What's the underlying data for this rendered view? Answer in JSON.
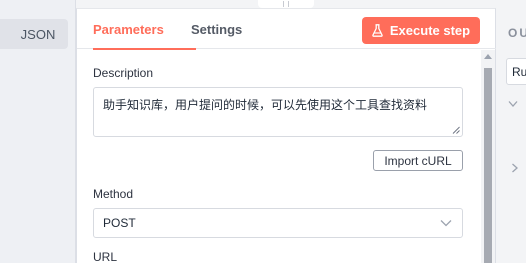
{
  "left_panel": {
    "json_label": "JSON"
  },
  "tabs": {
    "parameters": "Parameters",
    "settings": "Settings"
  },
  "execute_button": {
    "label": "Execute step",
    "icon": "flask-icon"
  },
  "fields": {
    "description": {
      "label": "Description",
      "value": "助手知识库，用户提问的时候，可以先使用这个工具查找资料"
    },
    "import_curl": "Import cURL",
    "method": {
      "label": "Method",
      "value": "POST"
    },
    "url": {
      "label": "URL"
    }
  },
  "right_panel": {
    "title": "OU",
    "input_value": "Ru"
  },
  "colors": {
    "accent": "#ff6d5a",
    "panel_bg": "#ffffff",
    "canvas_bg": "#f3f4f6"
  }
}
